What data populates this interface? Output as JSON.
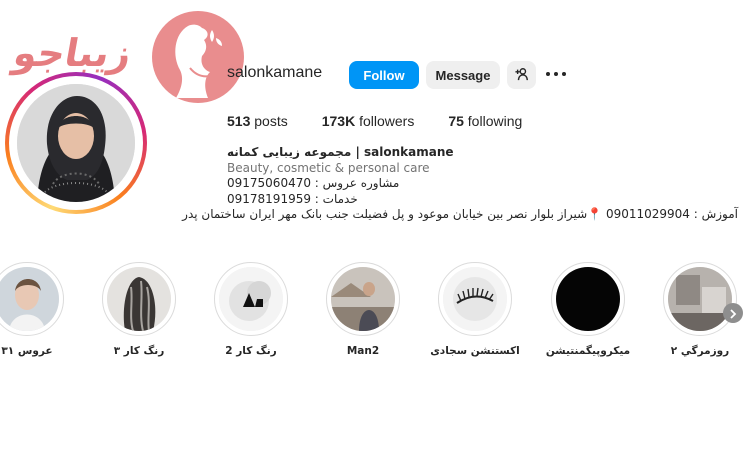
{
  "watermark": {
    "text": "زیباجو"
  },
  "profile": {
    "username": "salonkamane",
    "follow_label": "Follow",
    "message_label": "Message",
    "stats": {
      "posts_count": "513",
      "posts_label": "posts",
      "followers_count": "173K",
      "followers_label": "followers",
      "following_count": "75",
      "following_label": "following"
    },
    "bio": {
      "name": "مجموعه زیبایی کمانه | salonkamane",
      "category": "Beauty, cosmetic & personal care",
      "line1": "مشاوره عروس : 09175060470",
      "line2": "خدمات : 09178191959",
      "address": "آموزش : 09011029904 📍شیراز بلوار نصر بین خیابان موعود و پل فضیلت جنب بانک مهر ایران ساختمان پدر"
    }
  },
  "highlights": [
    {
      "label": "عروس ۳۱"
    },
    {
      "label": "رنگ کار ۳"
    },
    {
      "label": "رنگ کار 2"
    },
    {
      "label": "Man2"
    },
    {
      "label": "اکستنشن سجادی"
    },
    {
      "label": "میکروپیگمنتیشن"
    },
    {
      "label": "روزمرگي ۲"
    }
  ],
  "colors": {
    "follow_button": "#0095f6",
    "secondary_button": "#efefef",
    "watermark": "#e57d80"
  },
  "icons": {
    "add_user": "person-plus-icon",
    "more": "more-horizontal-icon",
    "next": "chevron-right-icon"
  }
}
